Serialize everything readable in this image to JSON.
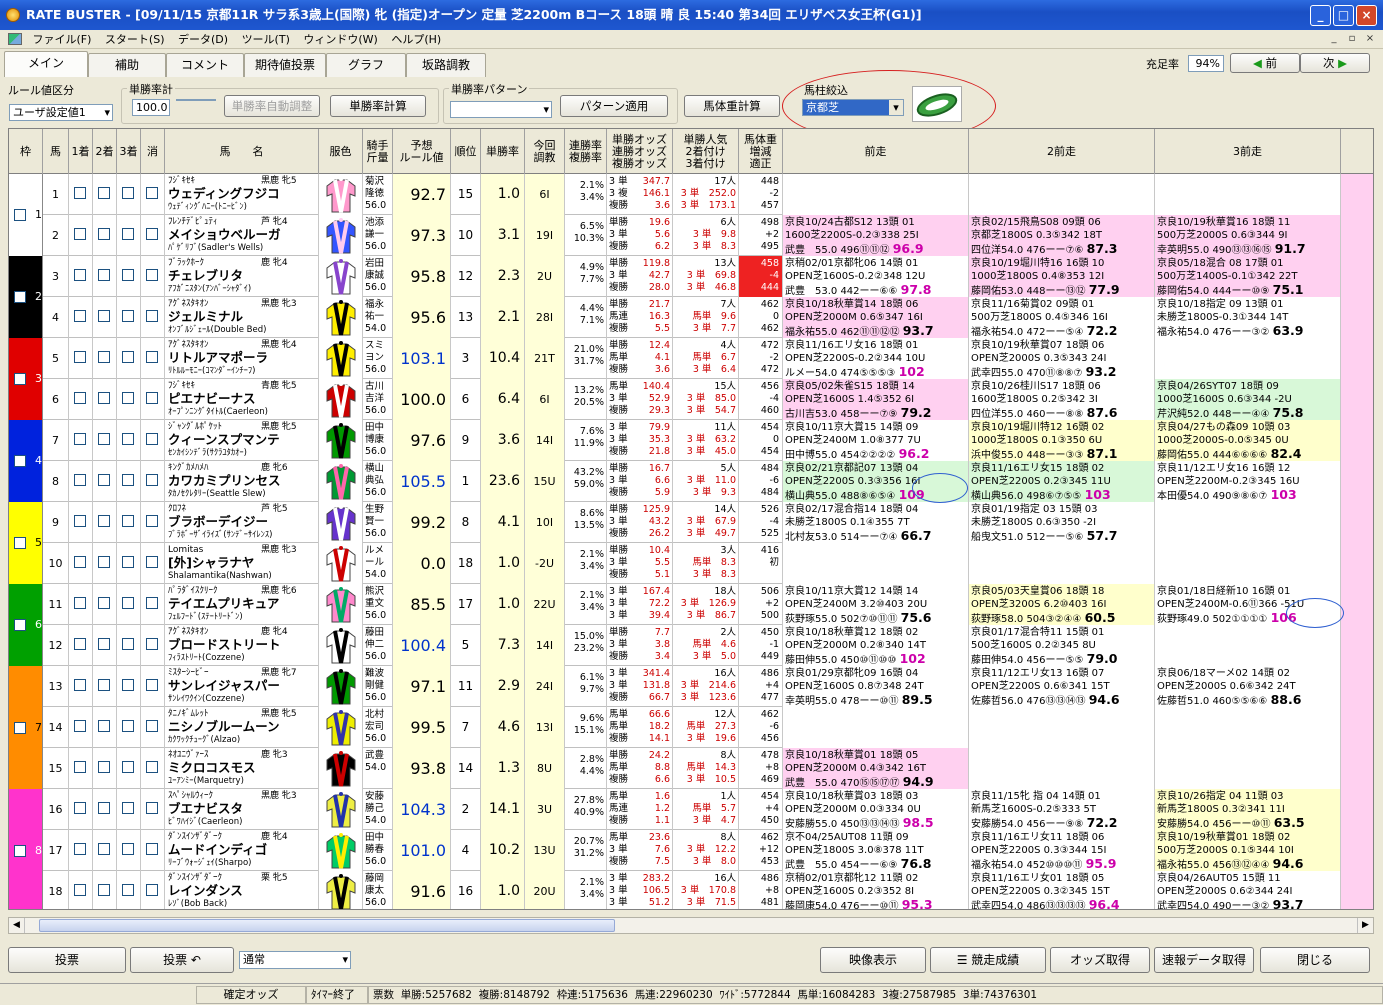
{
  "window": {
    "title": "RATE BUSTER - [09/11/15 京都11R サラ系3歳上(国際) 牝 (指定)オープン 定量 芝2200m Bコース 18頭 晴 良 15:40 第34回 エリザベス女王杯(G1)]",
    "min": "_",
    "max": "□",
    "close": "×"
  },
  "menu": [
    "ファイル(F)",
    "スタート(S)",
    "データ(D)",
    "ツール(T)",
    "ウィンドウ(W)",
    "ヘルプ(H)"
  ],
  "mdi": [
    "_",
    "▫",
    "×"
  ],
  "tabs": [
    "メイン",
    "補助",
    "コメント",
    "期待値投票",
    "グラフ",
    "坂路調教"
  ],
  "nav": {
    "fill_label": "充足率",
    "fill_value": "94%",
    "prev": "前",
    "next": "次"
  },
  "controls": {
    "rule_label": "ルール値区分",
    "rule_value": "ユーザ設定値1",
    "win_label": "単勝率計",
    "win_value": "100.0",
    "auto_btn": "単勝率自動調整",
    "calc_btn": "単勝率計算",
    "pattern_label": "単勝率パターン",
    "pattern_btn": "パターン適用",
    "weight_btn": "馬体重計算",
    "filter_label": "馬柱絞込",
    "filter_value": "京都芝"
  },
  "headers": {
    "waku": "枠",
    "uma": "馬",
    "p1": "1着",
    "p2": "2着",
    "p3": "3着",
    "kesu": "消",
    "name": "馬　　名",
    "fuku": "服色",
    "jockey": "騎手\n斤量",
    "rule": "予想\nルール値",
    "rank": "順位",
    "rate": "単勝率",
    "chokyo": "今回\n調教",
    "rentai": "連勝率\n複勝率",
    "odds": "単勝オッズ\n連勝オッズ\n複勝オッズ",
    "ninki": "単勝人気\n2着付け\n3着付け",
    "bw": "馬体重\n増減\n適正",
    "z1": "前走",
    "z2": "2前走",
    "z3": "3前走"
  },
  "horses": [
    {
      "no": "1",
      "sire": "ﾌｼﾞｷｾｷ",
      "sex": "黒鹿 牝5",
      "name": "ウェディングフジコ",
      "dam": "ｳｪﾃﾞｨﾝｸﾞﾊﾆｰ(ﾄﾆｰﾋﾞﾝ)",
      "j1": "菊沢",
      "j2": "隆徳",
      "kin": "56.0",
      "rule": "92.7",
      "rank": "15",
      "rate": "1.0",
      "ch": "6I",
      "r1": "2.1%",
      "r2": "3.4%",
      "o1": "3 単",
      "ov1": "347.7",
      "o2": "3 複",
      "ov2": "146.1",
      "o3": "複勝",
      "ov3": "3.6",
      "n1": "17人",
      "n2": "3 単　252.0",
      "n3": "3 単　173.1",
      "bw1": "448",
      "bw2": "-2",
      "bw3": "457",
      "past": [
        [],
        [],
        []
      ]
    },
    {
      "no": "2",
      "sire": "ﾌﾚﾝﾁﾃﾞﾋﾟｭﾃｨ",
      "sex": "芦 牝4",
      "name": "メイショウベルーガ",
      "dam": "ﾊﾟｹﾞﾘﾌﾞ(Sadler's Wells)",
      "j1": "池添",
      "j2": "謙一",
      "kin": "56.0",
      "rule": "97.3",
      "rank": "10",
      "rate": "3.1",
      "ch": "19I",
      "r1": "6.5%",
      "r2": "10.3%",
      "o1": "単勝",
      "ov1": "19.6",
      "o2": "3 単",
      "ov2": "5.6",
      "o3": "複勝",
      "ov3": "6.2",
      "n1": "6人",
      "n2": "3 単　9.8",
      "n3": "3 単　8.3",
      "bw1": "498",
      "bw2": "+2",
      "bw3": "495",
      "past": [
        [
          "京良10/24古都S12 13頭 01",
          "1600芝2200S-0.2③338 25I",
          "武豊　55.0 496⑪⑪⑫ 96.9"
        ],
        [
          "京良02/15飛鳥S08 09頭 06",
          "京都芝1800S 0.3⑤342 18T",
          "四位洋54.0 476ーー⑦⑥ 87.3"
        ],
        [
          "京良10/19秋華賞16 18頭 11",
          "500万芝2000S 0.6③344 9I",
          "幸英明55.0 490⑬⑬⑯⑮ 91.7"
        ]
      ]
    },
    {
      "no": "3",
      "sire": "ﾌﾞﾗｯｸﾎｰｸ",
      "sex": "鹿 牝4",
      "name": "チェレブリタ",
      "dam": "ｱﾌｶﾞﾆｽﾀﾝ(ｱﾝﾊﾞｰｼｬﾀﾞｲ)",
      "j1": "岩田",
      "j2": "康誠",
      "kin": "56.0",
      "rule": "95.8",
      "rank": "12",
      "rate": "2.3",
      "ch": "2U",
      "r1": "4.9%",
      "r2": "7.7%",
      "o1": "単勝",
      "ov1": "119.8",
      "o2": "3 単",
      "ov2": "42.7",
      "o3": "複勝",
      "ov3": "28.0",
      "n1": "13人",
      "n2": "3 単　69.8",
      "n3": "3 単　46.8",
      "bw1": "458",
      "bw2": "-4",
      "bw3": "444",
      "past": [
        [
          "京稍02/01京都牝06 14頭 01",
          "OPEN芝1600S-0.2②348 12U",
          "武豊　53.0 442ーー⑥⑥ 97.8"
        ],
        [
          "京良10/19堀川特16 16頭 10",
          "1000芝1800S 0.4⑧353 12I",
          "藤岡佑53.0 448ーー⑬⑫ 77.9"
        ],
        [
          "京良05/18混合 08 17頭 01",
          "500万芝1400S-0.1①342 22T",
          "藤岡佑54.0 444ーー⑩⑨ 75.1"
        ]
      ]
    },
    {
      "no": "4",
      "sire": "ｱｸﾞﾈｽﾀｷｵﾝ",
      "sex": "黒鹿 牝3",
      "name": "ジェルミナル",
      "dam": "ｵﾝﾌﾞﾙｼﾞｪｰﾙ(Double Bed)",
      "j1": "福永",
      "j2": "祐一",
      "kin": "54.0",
      "rule": "95.6",
      "rank": "13",
      "rate": "2.1",
      "ch": "28I",
      "r1": "4.4%",
      "r2": "7.1%",
      "o1": "単勝",
      "ov1": "21.7",
      "o2": "馬連",
      "ov2": "16.3",
      "o3": "複勝",
      "ov3": "5.5",
      "n1": "7人",
      "n2": "馬単　9.6",
      "n3": "3 単　7.7",
      "bw1": "462",
      "bw2": "0",
      "bw3": "462",
      "past": [
        [
          "京良10/18秋華賞14 18頭 06",
          "OPEN芝2000M 0.6⑤347 16I",
          "福永祐55.0 462⑪⑪⑫⑫ 93.7"
        ],
        [
          "京良11/16菊賞02 09頭 01",
          "500万芝1800S 0.4⑤346 16I",
          "福永祐54.0 472ーー⑤④ 72.2"
        ],
        [
          "京良10/18指定 09 13頭 01",
          "未勝芝1800S-0.3①344 14T",
          "福永祐54.0 476ーー③② 63.9"
        ]
      ]
    },
    {
      "no": "5",
      "sire": "ｱｸﾞﾈｽﾀｷｵﾝ",
      "sex": "黒鹿 牝4",
      "name": "リトルアマポーラ",
      "dam": "ﾘﾄﾙﾙｰﾓﾆｰ(ｺﾏﾝﾀﾞｰｲﾝﾁｰﾌ)",
      "j1": "スミ",
      "j2": "ヨン",
      "kin": "56.0",
      "rule": "103.1",
      "rank": "3",
      "rate": "10.4",
      "ch": "21T",
      "r1": "21.0%",
      "r2": "31.7%",
      "o1": "単勝",
      "ov1": "12.4",
      "o2": "馬単",
      "ov2": "4.1",
      "o3": "複勝",
      "ov3": "3.6",
      "n1": "4人",
      "n2": "馬単　6.7",
      "n3": "3 単　6.4",
      "bw1": "472",
      "bw2": "-2",
      "bw3": "472",
      "past": [
        [
          "京良11/16エリ女16 18頭 01",
          "OPEN芝2200S-0.2②344 10U",
          "ルメー54.0 474⑤⑤⑤③ 102"
        ],
        [
          "京良10/19秋華賞07 18頭 06",
          "OPEN芝2000S 0.3⑤343 24I",
          "武幸四55.0 470⑪⑧⑧⑦ 93.2"
        ],
        []
      ]
    },
    {
      "no": "6",
      "sire": "ﾌｼﾞｷｾｷ",
      "sex": "青鹿 牝5",
      "name": "ピエナビーナス",
      "dam": "ｵｰﾌﾟﾝﾆﾝｸﾞﾀｲﾄﾙ(Caerleon)",
      "j1": "古川",
      "j2": "吉洋",
      "kin": "56.0",
      "rule": "100.0",
      "rank": "6",
      "rate": "6.4",
      "ch": "6I",
      "r1": "13.2%",
      "r2": "20.5%",
      "o1": "馬単",
      "ov1": "140.4",
      "o2": "3 単",
      "ov2": "52.9",
      "o3": "複勝",
      "ov3": "29.3",
      "n1": "15人",
      "n2": "3 単　85.0",
      "n3": "3 単　54.7",
      "bw1": "456",
      "bw2": "-4",
      "bw3": "460",
      "past": [
        [
          "京良05/02朱雀S15 18頭 14",
          "OPEN芝1600S 1.4⑤352 6I",
          "古川吉53.0 458ーー⑦⑨ 79.2"
        ],
        [
          "京良10/26桂川S17 18頭 06",
          "1600芝1800S 0.2⑤342 3I",
          "四位洋55.0 460ーー⑧⑧ 87.6"
        ],
        [
          "京良04/26SYT07 18頭 09",
          "1000芝1600S 0.6③344 -2U",
          "芹沢純52.0 448ーー④④ 75.8"
        ]
      ]
    },
    {
      "no": "7",
      "sire": "ｼﾞｬﾝｸﾞﾙﾎﾟｹｯﾄ",
      "sex": "黒鹿 牝5",
      "name": "クィーンスプマンテ",
      "dam": "ｾﾝｶｲｼﾝﾃﾞﾗ(ｻｸﾗﾕﾀｶｵｰ)",
      "j1": "田中",
      "j2": "博康",
      "kin": "56.0",
      "rule": "97.6",
      "rank": "9",
      "rate": "3.6",
      "ch": "14I",
      "r1": "7.6%",
      "r2": "11.9%",
      "o1": "3 単",
      "ov1": "79.9",
      "o2": "3 単",
      "ov2": "35.3",
      "o3": "複勝",
      "ov3": "21.8",
      "n1": "11人",
      "n2": "3 単　63.2",
      "n3": "3 単　45.0",
      "bw1": "454",
      "bw2": "0",
      "bw3": "454",
      "past": [
        [
          "京良10/11京大賞15 14頭 09",
          "OPEN芝2400M 1.0⑧377 7U",
          "田中博55.0 454②②②② 96.2"
        ],
        [
          "京良10/19堀川特12 16頭 02",
          "1000芝1800S 0.1③350 6U",
          "浜中俊55.0 448ーー③③ 87.1"
        ],
        [
          "京良04/27もの森09 10頭 03",
          "1000芝2000S-0.0⑤345 0U",
          "藤岡佑55.0 444⑥⑥⑥⑥ 82.4"
        ]
      ]
    },
    {
      "no": "8",
      "sire": "ｷﾝｸﾞｶﾒﾊﾒﾊ",
      "sex": "鹿 牝6",
      "name": "カワカミプリンセス",
      "dam": "ﾀｶﾉｾｸﾚﾀﾘｰ(Seattle Slew)",
      "j1": "横山",
      "j2": "典弘",
      "kin": "56.0",
      "rule": "105.5",
      "rank": "1",
      "rate": "23.6",
      "ch": "15U",
      "r1": "43.2%",
      "r2": "59.0%",
      "o1": "単勝",
      "ov1": "16.7",
      "o2": "3 単",
      "ov2": "6.6",
      "o3": "複勝",
      "ov3": "5.9",
      "n1": "5人",
      "n2": "3 単　11.0",
      "n3": "3 単　9.3",
      "bw1": "484",
      "bw2": "-6",
      "bw3": "484",
      "past": [
        [
          "京良02/21京都記07 13頭 04",
          "OPEN芝2200S 0.3③356 16I",
          "横山典55.0 488⑧⑥⑤④ 109"
        ],
        [
          "京良11/16エリ女15 18頭 02",
          "OPEN芝2200S 0.2③345 11U",
          "横山典56.0 498⑥⑦⑤⑤ 103"
        ],
        [
          "京良11/12エリ女16 16頭 12",
          "OPEN芝2200M-0.2③345 16U",
          "本田優54.0 490⑨⑧⑥⑦ 103"
        ]
      ]
    },
    {
      "no": "9",
      "sire": "ｸﾛﾌﾈ",
      "sex": "芦 牝5",
      "name": "ブラボーデイジー",
      "dam": "ﾌﾞﾗﾎﾞｰｻﾞｲﾗｲｽﾞ(ｻﾝﾃﾞｰｻｲﾚﾝｽ)",
      "j1": "生野",
      "j2": "賢一",
      "kin": "56.0",
      "rule": "99.2",
      "rank": "8",
      "rate": "4.1",
      "ch": "10I",
      "r1": "8.6%",
      "r2": "13.5%",
      "o1": "単勝",
      "ov1": "125.9",
      "o2": "3 単",
      "ov2": "43.2",
      "o3": "複勝",
      "ov3": "26.2",
      "n1": "14人",
      "n2": "3 単　67.9",
      "n3": "3 単　49.7",
      "bw1": "526",
      "bw2": "-4",
      "bw3": "525",
      "past": [
        [
          "京良02/17混合指14 18頭 04",
          "未勝芝1800S 0.1④355 7T",
          "北村友53.0 514ーー⑦④ 66.7"
        ],
        [
          "京良01/19指定 03 15頭 03",
          "未勝芝1800S 0.6③350 -2I",
          "船曳文51.0 512ーー⑤⑥ 57.7"
        ],
        []
      ]
    },
    {
      "no": "10",
      "sire": "Lomitas",
      "sex": "黒鹿 牝3",
      "name": "[外]シャラナヤ",
      "dam": "Shalamantika(Nashwan)",
      "j1": "ルメ",
      "j2": "ール",
      "kin": "54.0",
      "rule": "0.0",
      "rank": "18",
      "rate": "1.0",
      "ch": "-2U",
      "r1": "2.1%",
      "r2": "3.4%",
      "o1": "単勝",
      "ov1": "10.4",
      "o2": "3 単",
      "ov2": "5.5",
      "o3": "複勝",
      "ov3": "5.1",
      "n1": "3人",
      "n2": "馬単　8.3",
      "n3": "3 単　8.3",
      "bw1": "416",
      "bw2": "初",
      "bw3": "",
      "past": [
        [],
        [],
        []
      ]
    },
    {
      "no": "11",
      "sire": "ﾊﾟﾗﾀﾞｲｽｸﾘｰｸ",
      "sex": "黒鹿 牝6",
      "name": "テイエムプリキュア",
      "dam": "ﾌｪﾙﾌｰﾄﾞ(ｽﾃｰﾄﾘｰﾄﾞﾝ)",
      "j1": "熊沢",
      "j2": "重文",
      "kin": "56.0",
      "rule": "85.5",
      "rank": "17",
      "rate": "1.0",
      "ch": "22U",
      "r1": "2.1%",
      "r2": "3.4%",
      "o1": "3 単",
      "ov1": "167.4",
      "o2": "3 単",
      "ov2": "72.2",
      "o3": "3 単",
      "ov3": "39.4",
      "n1": "18人",
      "n2": "3 単　126.9",
      "n3": "3 単　86.7",
      "bw1": "506",
      "bw2": "+2",
      "bw3": "500",
      "past": [
        [
          "京良10/11京大賞12 14頭 14",
          "OPEN芝2400M 3.2⑩403 20U",
          "荻野琢55.0 502⑦⑩⑪⑪ 75.6"
        ],
        [
          "京良05/03天皇賞06 18頭 18",
          "OPEN芝3200S 6.2⑩403 16I",
          "荻野琢58.0 504③②④④ 60.5"
        ],
        [
          "京良01/18日経新10 16頭 01",
          "OPEN芝2400M-0.6⑪366 -51U",
          "荻野琢49.0 502①①①① 106"
        ]
      ]
    },
    {
      "no": "12",
      "sire": "ｱｸﾞﾈｽﾀｷｵﾝ",
      "sex": "鹿 牝4",
      "name": "ブロードストリート",
      "dam": "ﾌｨﾗｽﾄﾘｰﾄ(Cozzene)",
      "j1": "藤田",
      "j2": "伸二",
      "kin": "56.0",
      "rule": "100.4",
      "rank": "5",
      "rate": "7.3",
      "ch": "14I",
      "r1": "15.0%",
      "r2": "23.2%",
      "o1": "単勝",
      "ov1": "7.7",
      "o2": "3 単",
      "ov2": "3.8",
      "o3": "複勝",
      "ov3": "3.4",
      "n1": "2人",
      "n2": "馬単　4.6",
      "n3": "3 単　5.0",
      "bw1": "450",
      "bw2": "-1",
      "bw3": "449",
      "past": [
        [
          "京良10/18秋華賞12 18頭 02",
          "OPEN芝2000M 0.2⑧340 14T",
          "藤田伸55.0 450⑩⑪⑩⑩ 102"
        ],
        [
          "京良01/17混合特11 15頭 01",
          "500芝1600S 0.2②345 8U",
          "藤田伸54.0 456ーー⑤⑤ 79.0"
        ],
        []
      ]
    },
    {
      "no": "13",
      "sire": "ﾐｽﾀｰｼｰﾋﾞｰ",
      "sex": "黒鹿 牝7",
      "name": "サンレイジャスパー",
      "dam": "ｻﾝﾚｲﾜｸｲﾝ(Cozzene)",
      "j1": "難波",
      "j2": "剛健",
      "kin": "56.0",
      "rule": "97.1",
      "rank": "11",
      "rate": "2.9",
      "ch": "24I",
      "r1": "6.1%",
      "r2": "9.7%",
      "o1": "3 単",
      "ov1": "341.4",
      "o2": "3 単",
      "ov2": "131.8",
      "o3": "複勝",
      "ov3": "66.7",
      "n1": "16人",
      "n2": "3 単　214.6",
      "n3": "3 単　123.6",
      "bw1": "486",
      "bw2": "+4",
      "bw3": "477",
      "past": [
        [
          "京良01/29京都牝09 16頭 04",
          "OPEN芝1600S 0.8⑦348 24T",
          "幸英明55.0 478ーー⑩⑪ 89.5"
        ],
        [
          "京良11/12エリ女13 16頭 07",
          "OPEN芝2200S 0.6⑥341 15T",
          "佐藤哲56.0 476⑬⑬⑭⑬ 94.6"
        ],
        [
          "京良06/18マーメ02 14頭 02",
          "OPEN芝2000S 0.6⑥342 24T",
          "佐藤哲51.0 460⑤⑤⑥⑥ 88.6"
        ]
      ]
    },
    {
      "no": "14",
      "sire": "ﾀﾆﾉｷﾞﾑﾚｯﾄ",
      "sex": "黒鹿 牝5",
      "name": "ニシノブルームーン",
      "dam": "ｶｸﾜｯｸﾁｭｰｸﾞ(Alzao)",
      "j1": "北村",
      "j2": "宏司",
      "kin": "56.0",
      "rule": "99.5",
      "rank": "7",
      "rate": "4.6",
      "ch": "13I",
      "r1": "9.6%",
      "r2": "15.1%",
      "o1": "馬単",
      "ov1": "66.6",
      "o2": "馬単",
      "ov2": "18.2",
      "o3": "複勝",
      "ov3": "14.1",
      "n1": "12人",
      "n2": "馬単　27.3",
      "n3": "3 単　19.6",
      "bw1": "462",
      "bw2": "-6",
      "bw3": "456",
      "past": [
        [],
        [],
        []
      ]
    },
    {
      "no": "15",
      "sire": "ﾈｵﾕﾆｳﾞｧｰｽ",
      "sex": "鹿 牝3",
      "name": "ミクロコスモス",
      "dam": "ﾕｰｱﾝﾐｰ(Marquetry)",
      "j1": "武豊",
      "j2": "",
      "kin": "54.0",
      "rule": "93.8",
      "rank": "14",
      "rate": "1.3",
      "ch": "8U",
      "r1": "2.8%",
      "r2": "4.4%",
      "o1": "単勝",
      "ov1": "24.2",
      "o2": "馬単",
      "ov2": "8.8",
      "o3": "複勝",
      "ov3": "6.6",
      "n1": "8人",
      "n2": "馬単　14.3",
      "n3": "3 単　10.5",
      "bw1": "478",
      "bw2": "+8",
      "bw3": "469",
      "past": [
        [
          "京良10/18秋華賞01 18頭 05",
          "OPEN芝2000M 0.4③342 16T",
          "武豊　55.0 470⑮⑮⑰⑰ 94.9"
        ],
        [],
        []
      ]
    },
    {
      "no": "16",
      "sire": "ｽﾍﾟｼｬﾙｳｨｰｸ",
      "sex": "黒鹿 牝3",
      "name": "ブエナビスタ",
      "dam": "ﾋﾞﾜﾊｲｼﾞ(Caerleon)",
      "j1": "安藤",
      "j2": "勝己",
      "kin": "54.0",
      "rule": "104.3",
      "rank": "2",
      "rate": "14.1",
      "ch": "3U",
      "r1": "27.8%",
      "r2": "40.9%",
      "o1": "馬単",
      "ov1": "1.6",
      "o2": "馬連",
      "ov2": "1.2",
      "o3": "複勝",
      "ov3": "1.1",
      "n1": "1人",
      "n2": "馬単　5.7",
      "n3": "3 単　4.7",
      "bw1": "454",
      "bw2": "+4",
      "bw3": "450",
      "past": [
        [
          "京良10/18秋華賞03 18頭 03",
          "OPEN芝2000M 0.0③334 0U",
          "安藤勝55.0 450⑬⑬⑭⑬ 98.5"
        ],
        [
          "京良11/15牝 指 04 14頭 01",
          "新馬芝1600S-0.2⑤333 5T",
          "安藤勝54.0 456ーー⑨⑧ 72.2"
        ],
        [
          "京良10/26指定 04 11頭 03",
          "新馬芝1800S 0.3②341 11I",
          "安藤勝54.0 456ーー⑩⑪ 63.5"
        ]
      ]
    },
    {
      "no": "17",
      "sire": "ﾀﾞﾝｽｲﾝｻﾞﾀﾞｰｸ",
      "sex": "鹿 牝4",
      "name": "ムードインディゴ",
      "dam": "ﾘｰﾌﾞｳｫｰｼﾞｪｲ(Sharpo)",
      "j1": "田中",
      "j2": "勝春",
      "kin": "56.0",
      "rule": "101.0",
      "rank": "4",
      "rate": "10.2",
      "ch": "13U",
      "r1": "20.7%",
      "r2": "31.2%",
      "o1": "馬単",
      "ov1": "23.6",
      "o2": "3 単",
      "ov2": "7.6",
      "o3": "複勝",
      "ov3": "7.5",
      "n1": "8人",
      "n2": "3 単　12.2",
      "n3": "3 単　8.0",
      "bw1": "462",
      "bw2": "+12",
      "bw3": "453",
      "past": [
        [
          "京不04/25AUT08 11頭 09",
          "OPEN芝1800S 3.0⑧378 11T",
          "武豊　55.0 454ーー⑥⑨ 76.8"
        ],
        [
          "京良11/16エリ女11 18頭 06",
          "OPEN芝2200S 0.3③344 15I",
          "福永祐54.0 452⑩⑩⑩⑪ 95.9"
        ],
        [
          "京良10/19秋華賞01 18頭 02",
          "500万芝2000S 0.1⑤344 10I",
          "福永祐55.0 456⑬⑫④④ 94.6"
        ]
      ]
    },
    {
      "no": "18",
      "sire": "ﾀﾞﾝｽｲﾝｻﾞﾀﾞｰｸ",
      "sex": "栗 牝5",
      "name": "レインダンス",
      "dam": "ﾚｿﾞ(Bob Back)",
      "j1": "藤岡",
      "j2": "康太",
      "kin": "56.0",
      "rule": "91.6",
      "rank": "16",
      "rate": "1.0",
      "ch": "20U",
      "r1": "2.1%",
      "r2": "3.4%",
      "o1": "3 単",
      "ov1": "283.2",
      "o2": "3 単",
      "ov2": "106.5",
      "o3": "3 単",
      "ov3": "51.2",
      "n1": "16人",
      "n2": "3 単　170.8",
      "n3": "3 単　71.5",
      "bw1": "486",
      "bw2": "+8",
      "bw3": "481",
      "past": [
        [
          "京稍02/01京都牝12 11頭 02",
          "OPEN芝1600S 0.2③352 8I",
          "藤岡康54.0 476ーー⑩⑪ 95.3"
        ],
        [
          "京良11/16エリ女01 18頭 05",
          "OPEN芝2200S 0.3②345 15T",
          "武幸四54.0 486⑬⑬⑬⑬ 96.4"
        ],
        [
          "京良04/26AUT05 15頭 11",
          "OPEN芝2000S 0.6②344 24I",
          "武幸四54.0 490ーー③② 93.7"
        ]
      ]
    }
  ],
  "bottom": {
    "tohyo": "投票",
    "tohyo2": "投票 ↶",
    "mode": "通常",
    "eizo": "映像表示",
    "seiseki": "競走成績",
    "odds": "オッズ取得",
    "sokuho": "速報データ取得",
    "close": "閉じる"
  },
  "status": [
    "確定オッズ",
    "ﾀｲﾏｰ終了",
    "票数",
    "単勝:5257682",
    "複勝:8148792",
    "枠連:5175636",
    "馬連:22960230",
    "ﾜｲﾄﾞ:5772844",
    "馬単:16084283",
    "3複:27587985",
    "3単:74376301"
  ]
}
